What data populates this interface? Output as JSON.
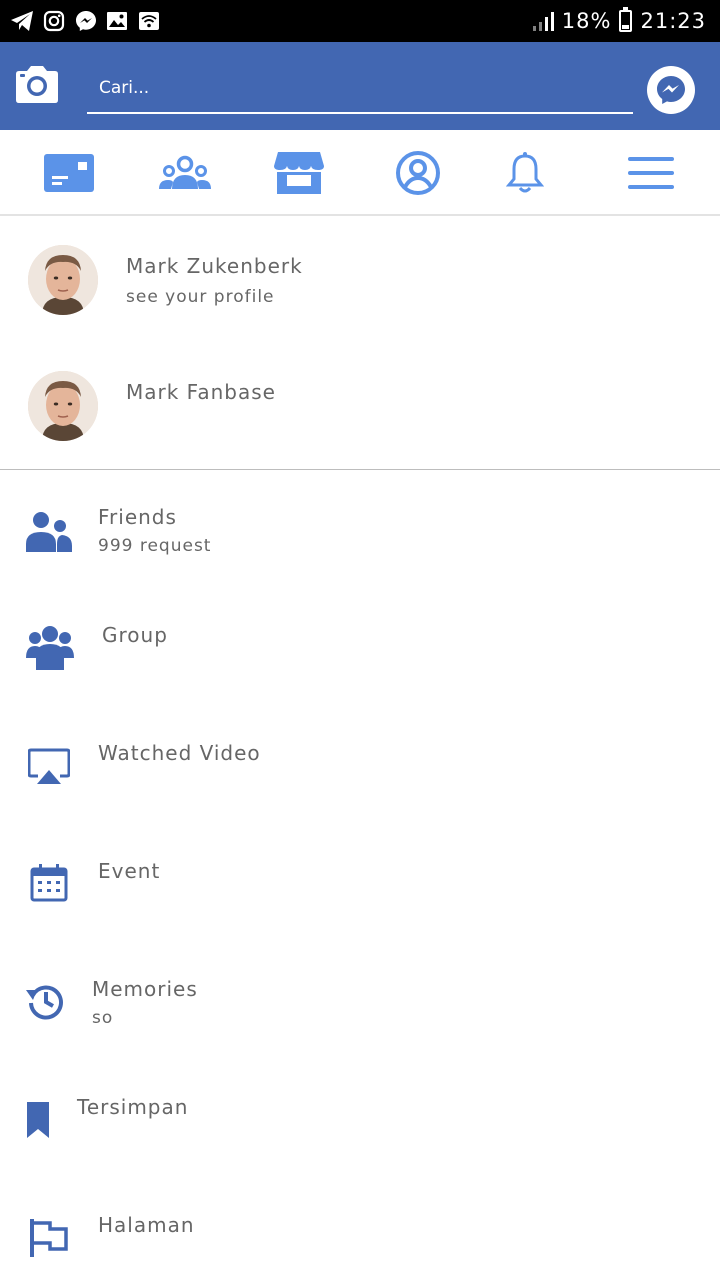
{
  "status_bar": {
    "battery": "18%",
    "time": "21:23",
    "app_icons": [
      "telegram-icon",
      "instagram-icon",
      "messenger-icon",
      "gallery-icon",
      "wifi-icon"
    ]
  },
  "header": {
    "search_placeholder": "Cari...",
    "brand_color": "#4267b2"
  },
  "nav": {
    "items": [
      "news-feed-icon",
      "friends-icon",
      "marketplace-icon",
      "profile-icon",
      "notifications-icon",
      "menu-icon"
    ],
    "active_color": "#5b93e8"
  },
  "profiles": [
    {
      "name": "Mark Zukenberk",
      "sub": "see your profile"
    },
    {
      "name": "Mark Fanbase",
      "sub": ""
    }
  ],
  "menu": {
    "items": [
      {
        "label": "Friends",
        "sub": "999 request",
        "icon": "friends-icon"
      },
      {
        "label": "Group",
        "sub": "",
        "icon": "group-icon"
      },
      {
        "label": "Watched Video",
        "sub": "",
        "icon": "video-icon"
      },
      {
        "label": "Event",
        "sub": "",
        "icon": "calendar-icon"
      },
      {
        "label": "Memories",
        "sub": "so",
        "icon": "memories-icon"
      },
      {
        "label": "Tersimpan",
        "sub": "",
        "icon": "bookmark-icon"
      },
      {
        "label": "Halaman",
        "sub": "",
        "icon": "flag-icon"
      }
    ],
    "icon_color": "#4267b2",
    "text_color": "#666666"
  }
}
